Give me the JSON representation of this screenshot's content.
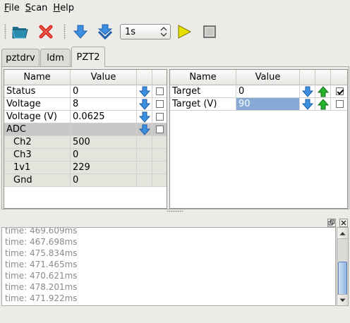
{
  "menu": [
    {
      "first": "F",
      "rest": "ile"
    },
    {
      "first": "S",
      "rest": "can"
    },
    {
      "first": "H",
      "rest": "elp"
    }
  ],
  "toolbar": {
    "interval": "1s",
    "icons": [
      "open-folder-icon",
      "delete-icon",
      "download-icon",
      "download-all-icon",
      "play-icon",
      "stop-icon"
    ]
  },
  "tabs": [
    "pztdrv",
    "ldm",
    "PZT2"
  ],
  "active_tab": "PZT2",
  "left_table": {
    "headers": [
      "Name",
      "Value"
    ],
    "rows": [
      {
        "name": "Status",
        "value": "0",
        "kind": "normal",
        "checked": false
      },
      {
        "name": "Voltage",
        "value": "8",
        "kind": "normal",
        "checked": false
      },
      {
        "name": "Voltage (V)",
        "value": "0.0625",
        "kind": "normal",
        "checked": false
      },
      {
        "name": "ADC",
        "value": "",
        "kind": "group",
        "checked": false
      },
      {
        "name": "Ch2",
        "value": "500",
        "kind": "sub"
      },
      {
        "name": "Ch3",
        "value": "0",
        "kind": "sub"
      },
      {
        "name": "1v1",
        "value": "229",
        "kind": "sub"
      },
      {
        "name": "Gnd",
        "value": "0",
        "kind": "sub"
      }
    ]
  },
  "right_table": {
    "headers": [
      "Name",
      "Value"
    ],
    "rows": [
      {
        "name": "Target",
        "value": "0",
        "checked": true,
        "selected": false
      },
      {
        "name": "Target (V)",
        "value": "90",
        "checked": false,
        "selected": true
      }
    ]
  },
  "log": [
    "time: 469.609ms",
    "time: 467.698ms",
    "time: 475.834ms",
    "time: 471.465ms",
    "time: 470.621ms",
    "time: 478.201ms",
    "time: 471.922ms"
  ],
  "colors": {
    "arrow_blue": "#3d8fe0",
    "arrow_green": "#25b32a",
    "delete_red": "#d9261c",
    "play_yellow": "#e8e000"
  }
}
